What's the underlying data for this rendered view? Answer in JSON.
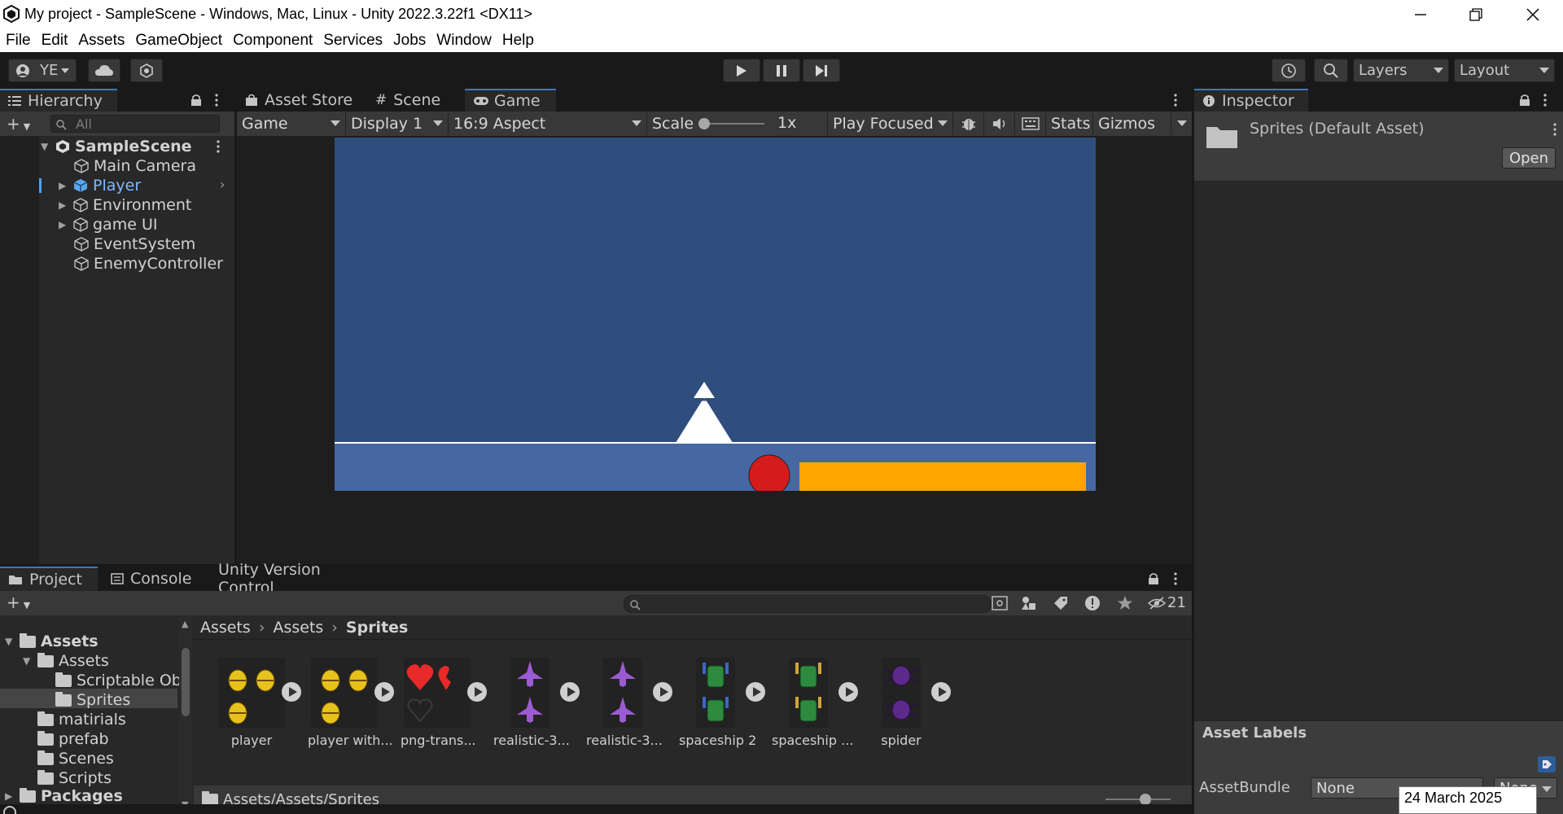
{
  "window": {
    "title": "My project - SampleScene - Windows, Mac, Linux - Unity 2022.3.22f1 <DX11>"
  },
  "menu": [
    "File",
    "Edit",
    "Assets",
    "GameObject",
    "Component",
    "Services",
    "Jobs",
    "Window",
    "Help"
  ],
  "toolbar": {
    "account": "YE",
    "layers": "Layers",
    "layout": "Layout"
  },
  "hierarchy": {
    "tab": "Hierarchy",
    "search_placeholder": "All",
    "scene": "SampleScene",
    "items": [
      "Main Camera",
      "Player",
      "Environment",
      "game UI",
      "EventSystem",
      "EnemyController"
    ]
  },
  "center_tabs": [
    "Asset Store",
    "Scene",
    "Game"
  ],
  "game_bar": {
    "mode": "Game",
    "display": "Display 1",
    "aspect": "16:9 Aspect",
    "scale_label": "Scale",
    "scale_value": "1x",
    "play_mode": "Play Focused",
    "stats": "Stats",
    "gizmos": "Gizmos"
  },
  "game_view": {
    "sky_color": "#2f4e7e",
    "ground_color": "#4767a3",
    "ball_color": "#d61b1b",
    "bar_color": "#ffa500"
  },
  "inspector": {
    "tab": "Inspector",
    "asset_title": "Sprites (Default Asset)",
    "open_button": "Open",
    "labels_title": "Asset Labels",
    "assetbundle_label": "AssetBundle",
    "assetbundle_value": "None",
    "assetbundle_variant": "None"
  },
  "bottom_tabs": [
    "Project",
    "Console",
    "Unity Version Control"
  ],
  "project": {
    "hidden_count": "21",
    "breadcrumb": [
      "Assets",
      "Assets",
      "Sprites"
    ],
    "tree": [
      {
        "label": "Assets",
        "bold": true
      },
      {
        "label": "Assets"
      },
      {
        "label": "Scriptable Obj"
      },
      {
        "label": "Sprites"
      },
      {
        "label": "matirials"
      },
      {
        "label": "prefab"
      },
      {
        "label": "Scenes"
      },
      {
        "label": "Scripts"
      },
      {
        "label": "Packages",
        "bold": true
      }
    ],
    "assets": [
      "player",
      "player with...",
      "png-trans...",
      "realistic-3...",
      "realistic-3...",
      "spaceship 2",
      "spaceship ...",
      "spider"
    ],
    "path": "Assets/Assets/Sprites"
  },
  "tooltip": {
    "date": "24 March 2025"
  }
}
